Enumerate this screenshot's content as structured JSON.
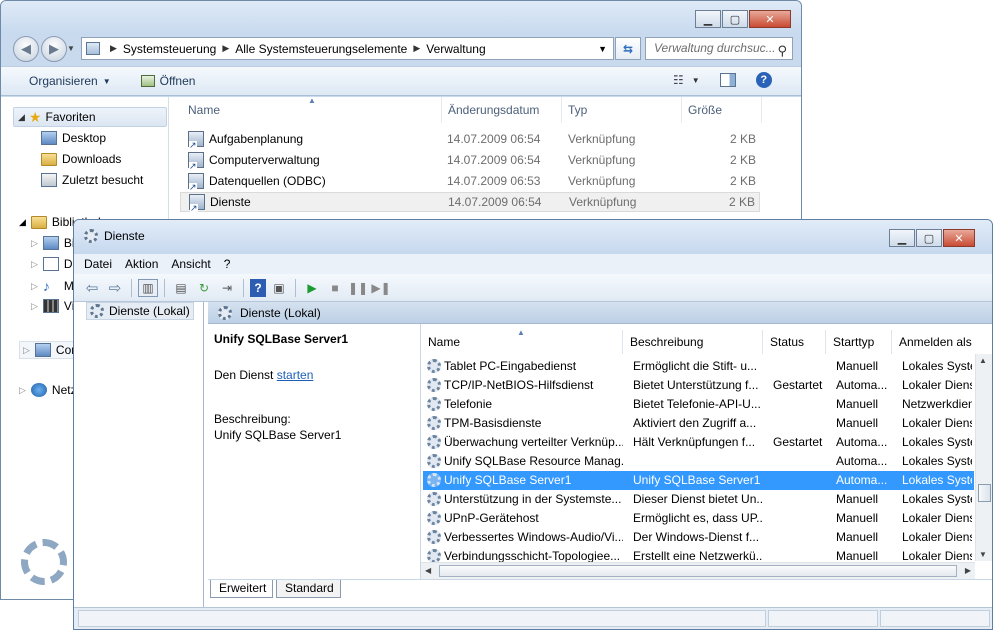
{
  "explorer": {
    "breadcrumb": [
      "Systemsteuerung",
      "Alle Systemsteuerungselemente",
      "Verwaltung"
    ],
    "search_placeholder": "Verwaltung durchsuc...",
    "toolbar": {
      "organize": "Organisieren",
      "open": "Öffnen"
    },
    "nav": {
      "favorites": "Favoriten",
      "favorite_items": [
        "Desktop",
        "Downloads",
        "Zuletzt besucht"
      ],
      "libraries": "Bibliotheken",
      "library_items": [
        "Bil",
        "Do",
        "M",
        "Vi"
      ],
      "computer": "Com",
      "network": "Netz"
    },
    "columns": {
      "name": "Name",
      "date": "Änderungsdatum",
      "type": "Typ",
      "size": "Größe"
    },
    "files": [
      {
        "name": "Aufgabenplanung",
        "date": "14.07.2009 06:54",
        "type": "Verknüpfung",
        "size": "2 KB"
      },
      {
        "name": "Computerverwaltung",
        "date": "14.07.2009 06:54",
        "type": "Verknüpfung",
        "size": "2 KB"
      },
      {
        "name": "Datenquellen (ODBC)",
        "date": "14.07.2009 06:53",
        "type": "Verknüpfung",
        "size": "2 KB"
      },
      {
        "name": "Dienste",
        "date": "14.07.2009 06:54",
        "type": "Verknüpfung",
        "size": "2 KB"
      }
    ]
  },
  "services": {
    "title": "Dienste",
    "menu": [
      "Datei",
      "Aktion",
      "Ansicht",
      "?"
    ],
    "tree_item": "Dienste (Lokal)",
    "detail_header": "Dienste (Lokal)",
    "selected_service": "Unify SQLBase Server1",
    "action_prefix": "Den Dienst",
    "action_link": "starten",
    "description_label": "Beschreibung:",
    "description_text": "Unify SQLBase Server1",
    "columns": {
      "name": "Name",
      "description": "Beschreibung",
      "status": "Status",
      "startup": "Starttyp",
      "logon": "Anmelden als"
    },
    "rows": [
      {
        "name": "Tablet PC-Eingabedienst",
        "desc": "Ermöglicht die Stift- u...",
        "status": "",
        "startup": "Manuell",
        "logon": "Lokales Syste"
      },
      {
        "name": "TCP/IP-NetBIOS-Hilfsdienst",
        "desc": "Bietet Unterstützung f...",
        "status": "Gestartet",
        "startup": "Automa...",
        "logon": "Lokaler Dienst"
      },
      {
        "name": "Telefonie",
        "desc": "Bietet Telefonie-API-U...",
        "status": "",
        "startup": "Manuell",
        "logon": "Netzwerkdien"
      },
      {
        "name": "TPM-Basisdienste",
        "desc": "Aktiviert den Zugriff a...",
        "status": "",
        "startup": "Manuell",
        "logon": "Lokaler Dienst"
      },
      {
        "name": "Überwachung verteilter Verknüp...",
        "desc": "Hält Verknüpfungen f...",
        "status": "Gestartet",
        "startup": "Automa...",
        "logon": "Lokales Syste"
      },
      {
        "name": "Unify SQLBase Resource Manag...",
        "desc": "",
        "status": "",
        "startup": "Automa...",
        "logon": "Lokales Syste"
      },
      {
        "name": "Unify SQLBase Server1",
        "desc": "Unify SQLBase Server1",
        "status": "",
        "startup": "Automa...",
        "logon": "Lokales Syste"
      },
      {
        "name": "Unterstützung in der Systemste...",
        "desc": "Dieser Dienst bietet Un...",
        "status": "",
        "startup": "Manuell",
        "logon": "Lokales Syste"
      },
      {
        "name": "UPnP-Gerätehost",
        "desc": "Ermöglicht es, dass UP...",
        "status": "",
        "startup": "Manuell",
        "logon": "Lokaler Dienst"
      },
      {
        "name": "Verbessertes Windows-Audio/Vi...",
        "desc": "Der Windows-Dienst f...",
        "status": "",
        "startup": "Manuell",
        "logon": "Lokaler Dienst"
      },
      {
        "name": "Verbindungsschicht-Topologiee...",
        "desc": "Erstellt eine Netzwerkü...",
        "status": "",
        "startup": "Manuell",
        "logon": "Lokaler Dienst"
      }
    ],
    "tabs": [
      "Erweitert",
      "Standard"
    ]
  }
}
